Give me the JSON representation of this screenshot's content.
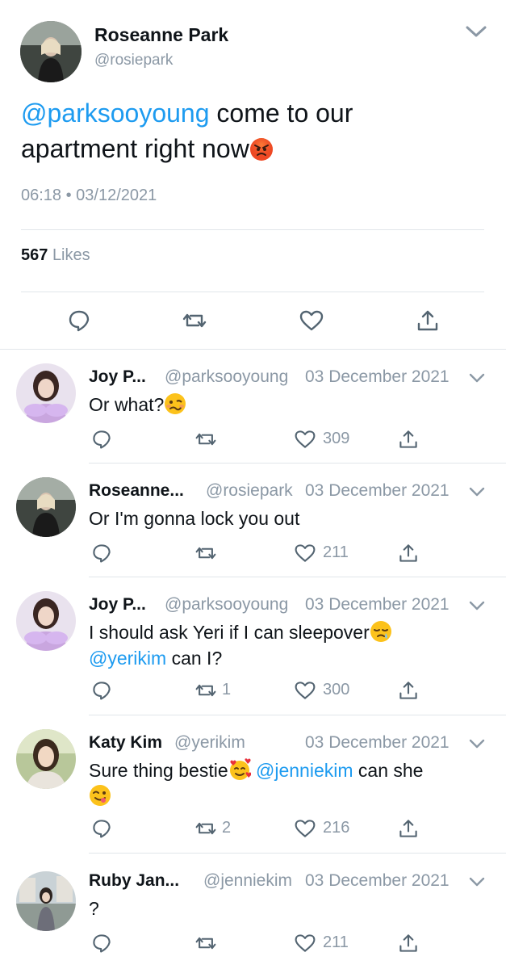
{
  "main_tweet": {
    "author_name": "Roseanne Park",
    "author_handle": "@rosiepark",
    "mention": "@parksooyoung",
    "text_after_mention": " come to our apartment right now",
    "emoji": "angry-face",
    "timestamp": "06:18 • 03/12/2021",
    "likes_count": "567",
    "likes_label": "Likes",
    "avatar_icon": "avatar-photo"
  },
  "replies": [
    {
      "name": "Joy P...",
      "handle": "@parksooyoung",
      "date": "03 December 2021",
      "text": "Or what?",
      "emoji": "woozy-face",
      "retweets": "",
      "likes": "309"
    },
    {
      "name": "Roseanne...",
      "handle": "@rosiepark",
      "date": "03 December 2021",
      "text": "Or I'm gonna lock you out",
      "retweets": "",
      "likes": "211"
    },
    {
      "name": "Joy P...",
      "handle": "@parksooyoung",
      "date": "03 December 2021",
      "text_part1": "I should ask Yeri if I can sleepover",
      "emoji": "sleepy-face",
      "mention": "@yerikim",
      "text_part2": " can I?",
      "retweets": "1",
      "likes": "300"
    },
    {
      "name": "Katy Kim",
      "handle": "@yerikim",
      "date": "03 December 2021",
      "text_part1": "Sure thing bestie",
      "emoji1": "smiling-face-with-hearts",
      "mention": "@jenniekim",
      "text_part2": " can she",
      "emoji2": "face-savoring-food",
      "retweets": "2",
      "likes": "216"
    },
    {
      "name": "Ruby Jan...",
      "handle": "@jenniekim",
      "date": "03 December 2021",
      "text": "?",
      "retweets": "",
      "likes": "211"
    }
  ],
  "colors": {
    "accent": "#1d9bf0",
    "secondary_text": "#8b98a5",
    "primary_text": "#0f1419",
    "divider": "#e1e6ea"
  }
}
